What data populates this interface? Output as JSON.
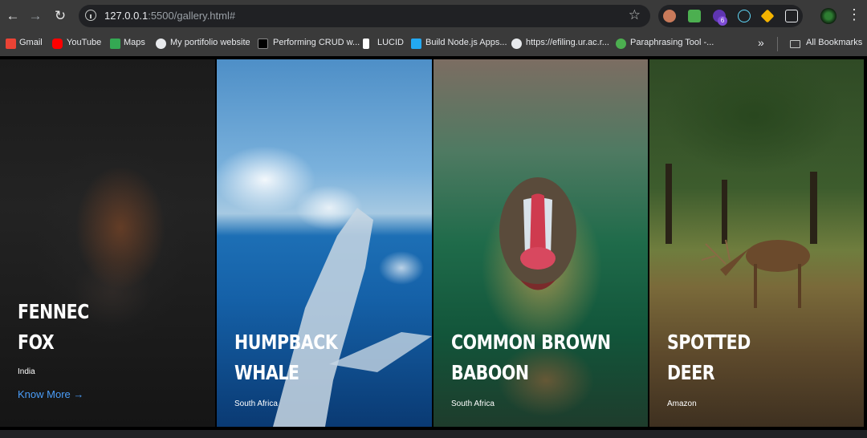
{
  "browser": {
    "url_host": "127.0.0.1",
    "url_rest": ":5500/gallery.html#",
    "extension_badge": "6",
    "icons": [
      "back-icon",
      "forward-icon",
      "reload-icon",
      "info-icon",
      "star-icon",
      "menu-icon"
    ]
  },
  "bookmarks": [
    {
      "label": "Gmail"
    },
    {
      "label": "YouTube"
    },
    {
      "label": "Maps"
    },
    {
      "label": "My portifolio website"
    },
    {
      "label": "Performing CRUD w..."
    },
    {
      "label": "LUCID"
    },
    {
      "label": "Build Node.js Apps..."
    },
    {
      "label": "https://efiling.ur.ac.r..."
    },
    {
      "label": "Paraphrasing Tool -..."
    }
  ],
  "all_bookmarks": "All Bookmarks",
  "gallery": {
    "cards": [
      {
        "title_line1": "Fennec",
        "title_line2": "Fox",
        "location": "India",
        "link": "Know More →"
      },
      {
        "title_line1": "Humpback",
        "title_line2": "Whale",
        "location": "South Africa"
      },
      {
        "title_line1": "Common Brown",
        "title_line2": "Baboon",
        "location": "South Africa"
      },
      {
        "title_line1": "Spotted",
        "title_line2": "Deer",
        "location": "Amazon"
      }
    ]
  },
  "colors": {
    "link": "#4a9df8",
    "toolbar": "#3a3a3a",
    "omnibox": "#202124"
  }
}
